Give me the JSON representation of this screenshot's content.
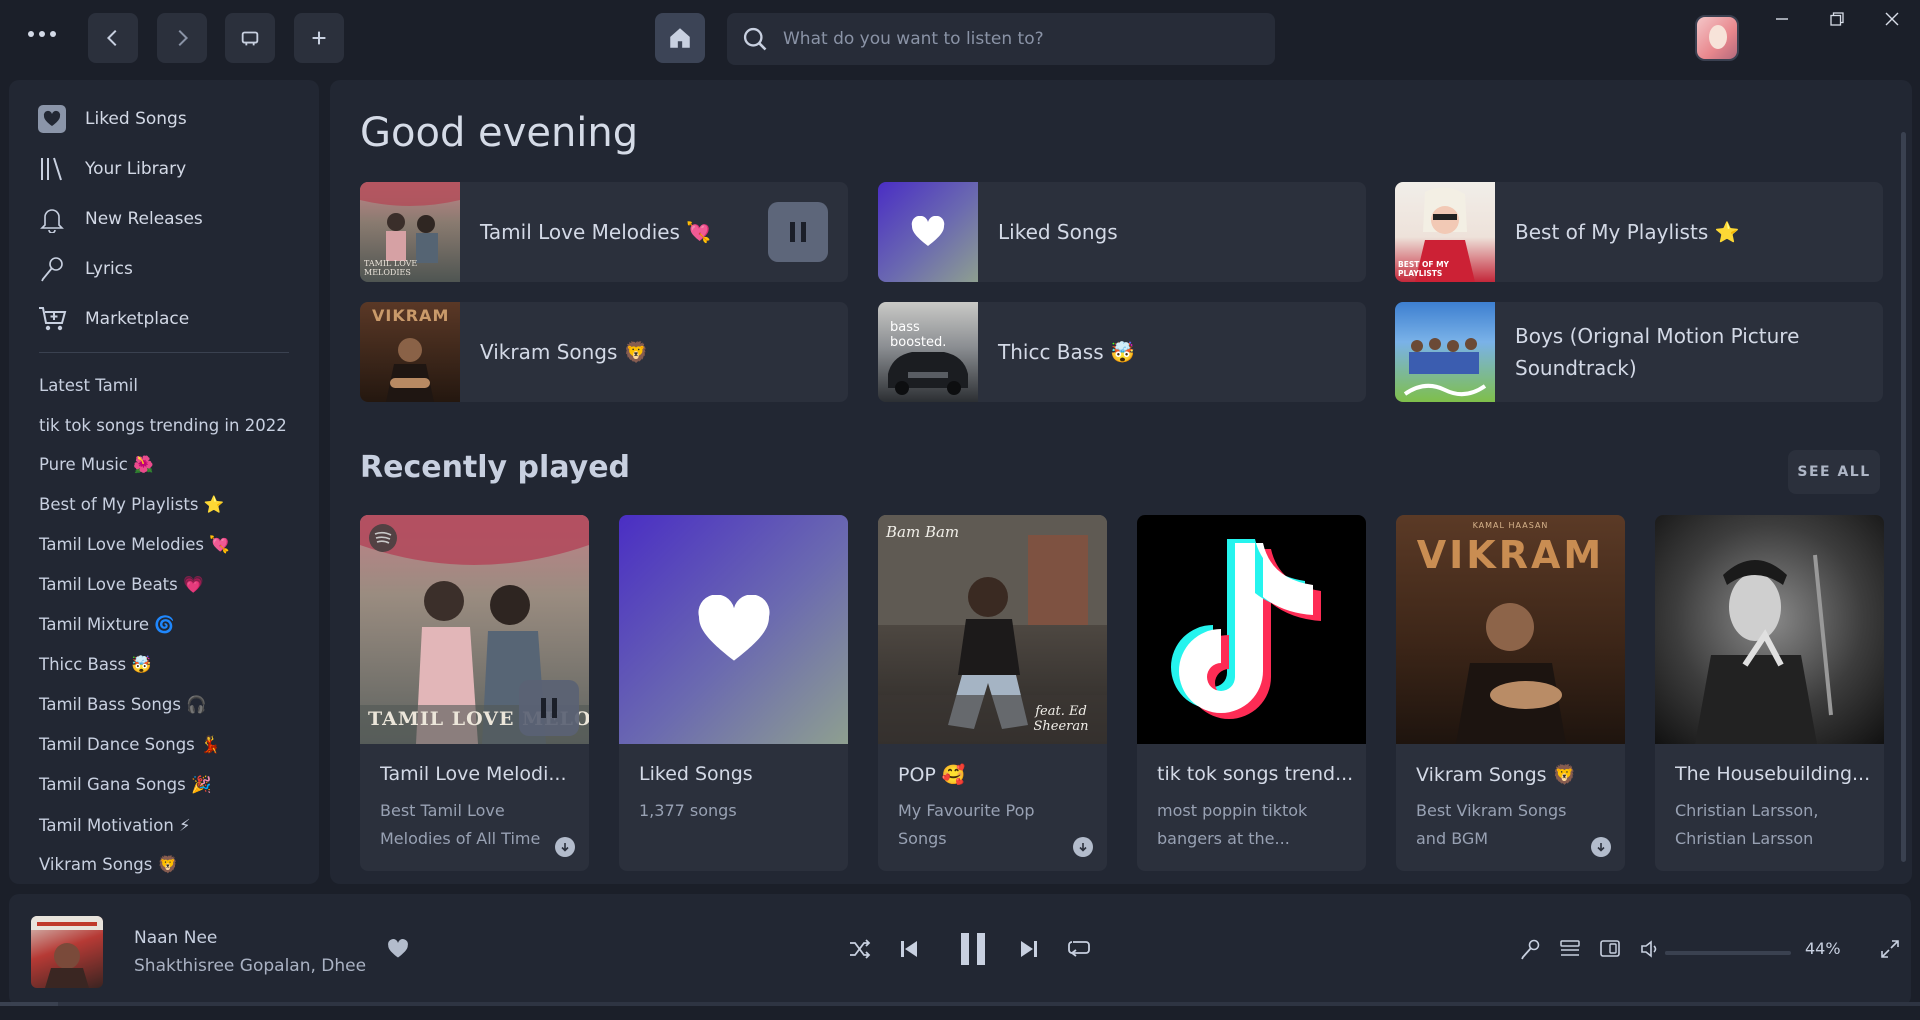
{
  "topbar": {
    "search_placeholder": "What do you want to listen to?",
    "window_controls": [
      "minimize-icon",
      "restore-icon",
      "close-icon"
    ]
  },
  "sidebar": {
    "nav": [
      {
        "label": "Liked Songs",
        "icon": "heart-square-icon"
      },
      {
        "label": "Your Library",
        "icon": "library-icon"
      },
      {
        "label": "New Releases",
        "icon": "bell-icon"
      },
      {
        "label": "Lyrics",
        "icon": "microphone-icon"
      },
      {
        "label": "Marketplace",
        "icon": "cart-icon"
      }
    ],
    "playlists": [
      "Latest Tamil",
      "tik tok songs trending in 2022",
      "Pure Music 🌺",
      "Best of My Playlists ⭐",
      "Tamil Love Melodies 💘",
      "Tamil Love Beats 💗",
      "Tamil Mixture 🌀",
      "Thicc Bass 🤯",
      "Tamil Bass Songs 🎧",
      "Tamil Dance Songs 💃",
      "Tamil Gana Songs 🎉",
      "Tamil Motivation ⚡",
      "Vikram Songs 🦁"
    ]
  },
  "main": {
    "greeting": "Good evening",
    "quick_picks": [
      {
        "label": "Tamil Love Melodies 💘",
        "playing": true
      },
      {
        "label": "Liked Songs",
        "playing": false
      },
      {
        "label": "Best of My Playlists ⭐",
        "playing": false
      },
      {
        "label": "Vikram Songs 🦁",
        "playing": false
      },
      {
        "label": "Thicc Bass 🤯",
        "playing": false
      },
      {
        "label": "Boys (Orignal Motion Picture Soundtrack)",
        "playing": false
      }
    ],
    "recently_played_title": "Recently played",
    "see_all": "SEE ALL",
    "cards": [
      {
        "title": "Tamil Love Melodi...",
        "subtitle": "Best Tamil Love Melodies of All Time",
        "downloaded": true,
        "playing": true
      },
      {
        "title": "Liked Songs",
        "subtitle": "1,377 songs",
        "downloaded": false,
        "playing": false
      },
      {
        "title": "POP 🥰",
        "subtitle": "My Favourite Pop Songs",
        "downloaded": true,
        "playing": false
      },
      {
        "title": "tik tok songs trend...",
        "subtitle": "most poppin tiktok bangers at the...",
        "downloaded": false,
        "playing": false
      },
      {
        "title": "Vikram Songs 🦁",
        "subtitle": "Best Vikram Songs and BGM",
        "downloaded": true,
        "playing": false
      },
      {
        "title": "The Housebuilding...",
        "subtitle": "Christian Larsson, Christian Larsson",
        "downloaded": false,
        "playing": false
      }
    ],
    "art_text": {
      "tamil_love": "TAMIL LOVE MELODIES",
      "best_of": "BEST OF MY PLAYLISTS",
      "vikram": "VIKRAM",
      "bass": "bass boosted.",
      "pop_1": "Bam Bam",
      "pop_2": "feat. Ed Sheeran",
      "vikram_card_top": "KAMAL HAASAN",
      "vikram_card_title": "VIKRAM"
    }
  },
  "player": {
    "title": "Naan Nee",
    "artist": "Shakthisree Gopalan, Dhee",
    "volume_percent_label": "44%",
    "volume_level": 0.44,
    "progress_fraction": 0.03,
    "liked": true,
    "state": "playing"
  },
  "colors": {
    "background": "#1b1f29",
    "panel": "#222733",
    "card": "#2b303c",
    "text": "#c8d0e0",
    "muted": "#98a1b3"
  }
}
